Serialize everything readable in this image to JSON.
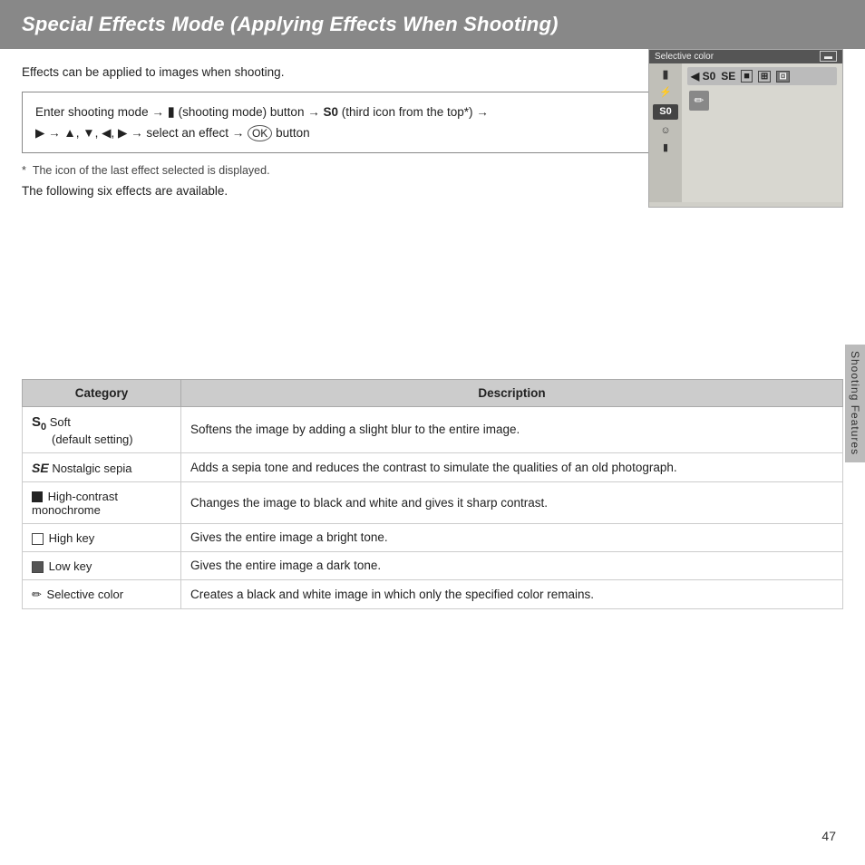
{
  "header": {
    "title": "Special Effects Mode (Applying Effects When Shooting)"
  },
  "intro": {
    "text": "Effects can be applied to images when shooting."
  },
  "instruction": {
    "line1": "Enter shooting mode → ",
    "camera_icon": "📷",
    "line1b": " (shooting mode) button → ",
    "so_icon": "SO",
    "line1c": " (third icon from the top*) →",
    "line2": "▶ → ▲, ▼, ◀, ▶ → select an effect → ",
    "ok_icon": "⊛",
    "line2b": " button"
  },
  "footnote": {
    "marker": "*",
    "text": "The icon of the last effect selected is displayed."
  },
  "following_text": "The following six effects are available.",
  "camera_ui": {
    "title": "Selective color",
    "left_icons": [
      "📷",
      "⚡",
      "SO",
      "😊",
      "📷"
    ],
    "top_row": [
      "◀ SO",
      "SE",
      "■",
      "⊞",
      "⊡"
    ],
    "pencil": "✏"
  },
  "table": {
    "col_category": "Category",
    "col_description": "Description",
    "rows": [
      {
        "icon": "SO",
        "icon_type": "soft",
        "label": "Soft\n(default setting)",
        "description": "Softens the image by adding a slight blur to the entire image."
      },
      {
        "icon": "SE",
        "icon_type": "se",
        "label": "Nostalgic sepia",
        "description": "Adds a sepia tone and reduces the contrast to simulate the qualities of an old photograph."
      },
      {
        "icon": "■",
        "icon_type": "hc",
        "label": "High-contrast monochrome",
        "description": "Changes the image to black and white and gives it sharp contrast."
      },
      {
        "icon": "⊞",
        "icon_type": "hk",
        "label": "High key",
        "description": "Gives the entire image a bright tone."
      },
      {
        "icon": "⊡",
        "icon_type": "lk",
        "label": "Low key",
        "description": "Gives the entire image a dark tone."
      },
      {
        "icon": "✏",
        "icon_type": "pencil",
        "label": "Selective color",
        "description": "Creates a black and white image in which only the specified color remains."
      }
    ]
  },
  "sidebar": {
    "label": "Shooting Features"
  },
  "page_number": "47"
}
